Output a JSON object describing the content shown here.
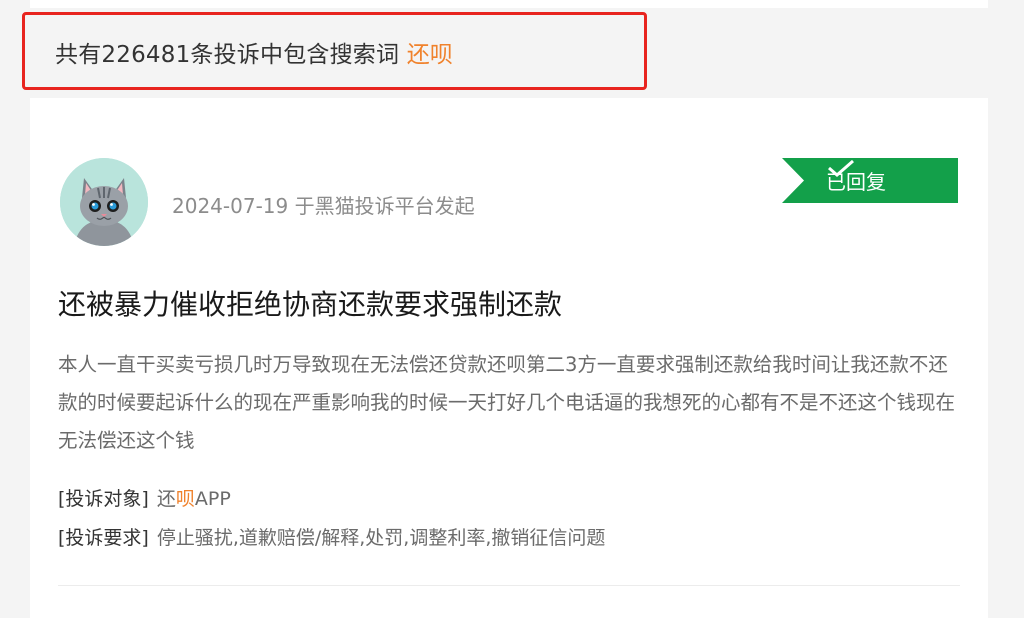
{
  "summary": {
    "prefix": "共有226481条投诉中包含搜索词",
    "keyword": "还呗"
  },
  "complaint": {
    "date": "2024-07-19",
    "source": "于黑猫投诉平台发起",
    "status": "已回复",
    "title": "还被暴力催收拒绝协商还款要求强制还款",
    "body": "本人一直干买卖亏损几时万导致现在无法偿还贷款还呗第二3方一直要求强制还款给我时间让我还款不还款的时候要起诉什么的现在严重影响我的时候一天打好几个电话逼的我想死的心都有不是不还这个钱现在无法偿还这个钱",
    "target_label": "[投诉对象]",
    "target_prefix": "还",
    "target_keyword": "呗",
    "target_suffix": "APP",
    "demand_label": "[投诉要求]",
    "demand_value": "停止骚扰,道歉赔偿/解释,处罚,调整利率,撤销征信问题"
  },
  "colors": {
    "keyword": "#f0822c",
    "status_green": "#13a04a",
    "highlight_red": "#e8241f"
  },
  "icons": {
    "avatar": "cat-avatar-icon",
    "status": "checkmark-icon"
  }
}
